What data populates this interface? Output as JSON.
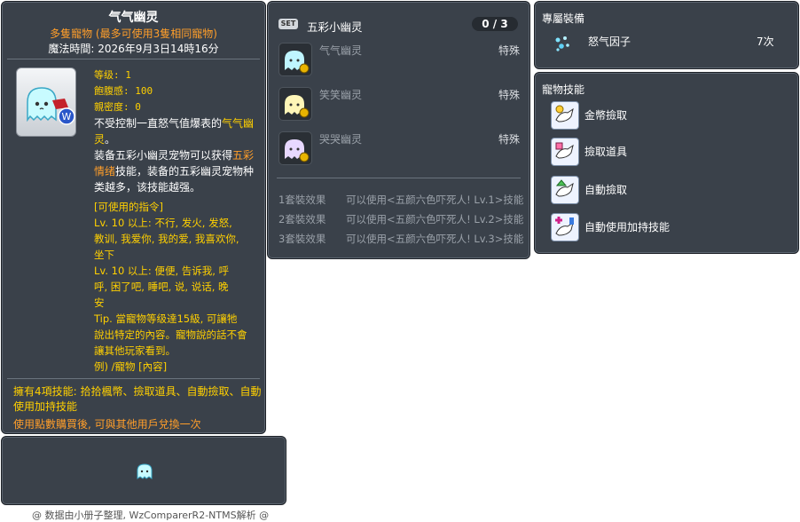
{
  "id_tag": "05002531",
  "main": {
    "title": "气气幽灵",
    "subtitle": "多隻寵物 (最多可使用3隻相同寵物)",
    "magic_time": "魔法時間: 2026年9月3日14時16分",
    "stats": {
      "level": "等级: 1",
      "fullness": "飽腹感: 100",
      "closeness": "親密度: 0"
    },
    "desc": {
      "line1a": "不受控制一直怒气值爆表的",
      "line1b": "气气幽",
      "line2a": "灵",
      "line2b": "。",
      "line3a": "装备五彩小幽灵宠物可以获得",
      "line3b": "五彩",
      "line4a": "情绪",
      "line4b": "技能，装备的五彩幽灵宠物种",
      "line5": "类越多，该技能越强。"
    },
    "commands": {
      "header": "[可使用的指令]",
      "lv1_a": "Lv. 10 以上:  不行, 发火, 发怒,",
      "lv1_b": "教训, 我爱你, 我的爱, 我喜欢你,",
      "lv1_c": "坐下",
      "lv2_a": "Lv. 10 以上:  便便, 告诉我, 呼",
      "lv2_b": "呼, 困了吧, 睡吧, 说, 说话, 晚",
      "lv2_c": "安",
      "tip_a": "Tip. 當寵物等级達15級, 可讓牠",
      "tip_b": "說出特定的內容。寵物說的話不會",
      "tip_c": "讓其他玩家看到。",
      "tip_d": "例) /寵物 [內容]"
    },
    "footer": {
      "skills_line": "擁有4項技能: 拾拾楓幣、撿取道具、自動撿取、自動使用加持技能",
      "trade_line": "使用點數購買後, 可與其他用戶兌換一次"
    }
  },
  "set": {
    "badge": "SET",
    "name": "五彩小幽灵",
    "count": "0 / 3",
    "items": [
      {
        "name": "气气幽灵",
        "type": "特殊",
        "color": "#bff5ff"
      },
      {
        "name": "笑笑幽灵",
        "type": "特殊",
        "color": "#fff6b8"
      },
      {
        "name": "哭哭幽灵",
        "type": "特殊",
        "color": "#e8d8ff"
      }
    ],
    "effects": [
      {
        "label": "1套裝效果",
        "text": "可以使用<五颜六色吓死人! Lv.1>技能"
      },
      {
        "label": "2套裝效果",
        "text": "可以使用<五颜六色吓死人! Lv.2>技能"
      },
      {
        "label": "3套裝效果",
        "text": "可以使用<五颜六色吓死人! Lv.3>技能"
      }
    ]
  },
  "exclusive": {
    "title": "專屬裝備",
    "item_name": "怒气因子",
    "item_count": "7次"
  },
  "skills": {
    "title": "寵物技能",
    "items": [
      {
        "name": "金幣撿取",
        "icon": "meso-pickup-icon"
      },
      {
        "name": "撿取道具",
        "icon": "item-pickup-icon"
      },
      {
        "name": "自動撿取",
        "icon": "auto-pickup-icon"
      },
      {
        "name": "自動使用加持技能",
        "icon": "auto-buff-icon"
      }
    ]
  },
  "credit": "@ 数据由小册子整理, WzComparerR2-NTMS解析 @"
}
